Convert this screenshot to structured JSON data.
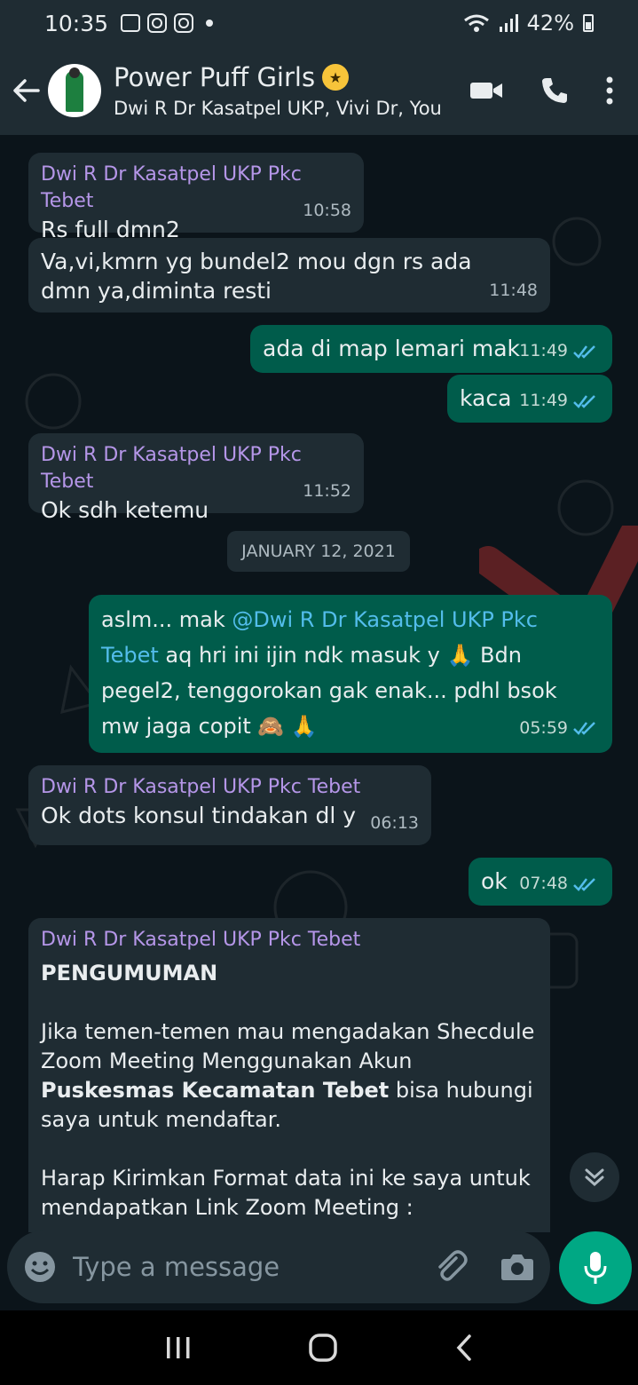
{
  "status": {
    "time": "10:35",
    "battery": "42%"
  },
  "header": {
    "title": "Power Puff Girls",
    "subtitle": "Dwi R Dr Kasatpel UKP, Vivi Dr, You"
  },
  "messages": [
    {
      "sender": "Dwi R Dr Kasatpel UKP Pkc Tebet",
      "text": "Rs full dmn2",
      "time": "10:58"
    },
    {
      "text": "Va,vi,kmrn yg bundel2 mou dgn rs ada dmn ya,diminta resti",
      "time": "11:48"
    },
    {
      "text": "ada di map lemari mak",
      "time": "11:49"
    },
    {
      "text": "kaca",
      "time": "11:49"
    },
    {
      "sender": "Dwi R Dr Kasatpel UKP Pkc Tebet",
      "text": "Ok sdh ketemu",
      "time": "11:52"
    },
    {
      "date": "JANUARY 12, 2021"
    },
    {
      "text_prefix": "aslm... mak ",
      "mention": "@Dwi R Dr Kasatpel UKP Pkc Tebet",
      "text_suffix": " aq hri ini ijin ndk masuk y 🙏 Bdn pegel2, tenggorokan gak enak... pdhl bsok mw jaga copit 🙈 🙏",
      "time": "05:59"
    },
    {
      "sender": "Dwi R Dr Kasatpel UKP Pkc Tebet",
      "text": "Ok dots konsul tindakan dl y",
      "time": "06:13"
    },
    {
      "text": "ok",
      "time": "07:48"
    },
    {
      "sender": "Dwi R Dr Kasatpel UKP Pkc Tebet",
      "heading": "PENGUMUMAN",
      "p1_prefix": "Jika temen-temen mau mengadakan Shecdule Zoom Meeting Menggunakan Akun ",
      "p1_bold": "Puskesmas Kecamatan Tebet",
      "p1_suffix": " bisa hubungi saya untuk mendaftar.",
      "p2": "Harap Kirimkan Format data ini ke saya untuk mendapatkan Link Zoom Meeting :"
    }
  ],
  "composer": {
    "placeholder": "Type a message"
  },
  "colors": {
    "incoming": "#1f2c33",
    "outgoing": "#005c4b",
    "accent": "#00a884",
    "sender": "#b596e8",
    "mention": "#53bdeb",
    "read_ticks": "#53bdeb"
  },
  "icons": [
    "back-arrow-icon",
    "video-call-icon",
    "phone-icon",
    "more-vert-icon",
    "emoji-icon",
    "attach-icon",
    "camera-icon",
    "mic-icon",
    "scroll-down-icon",
    "read-ticks-icon"
  ]
}
